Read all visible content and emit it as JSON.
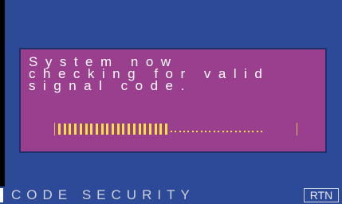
{
  "dialog": {
    "message_lines": [
      "System now",
      "checking for valid",
      "signal code."
    ]
  },
  "progress": {
    "filled_segments": 21,
    "total_segments": 43,
    "fraction": 0.49
  },
  "footer": {
    "title": "CODE SECURITY",
    "return_label": "RTN"
  },
  "colors": {
    "background": "#2c4a98",
    "dialog": "#9a3f8d",
    "progress_accent": "#f3e23c",
    "text": "#ffffff"
  }
}
